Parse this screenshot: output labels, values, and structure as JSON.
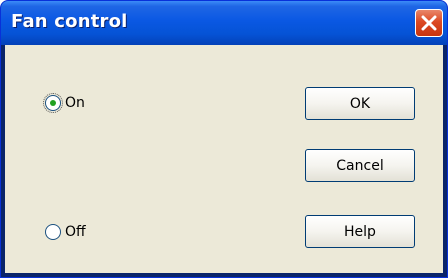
{
  "window": {
    "title": "Fan control",
    "close_icon": "close-icon"
  },
  "radios": [
    {
      "label": "On",
      "selected": true
    },
    {
      "label": "Off",
      "selected": false
    }
  ],
  "buttons": {
    "ok": "OK",
    "cancel": "Cancel",
    "help": "Help"
  },
  "colors": {
    "titlebar": "#0553d6",
    "close_button": "#dc4a24",
    "dialog_background": "#ece9d8",
    "radio_dot": "#21a121"
  }
}
